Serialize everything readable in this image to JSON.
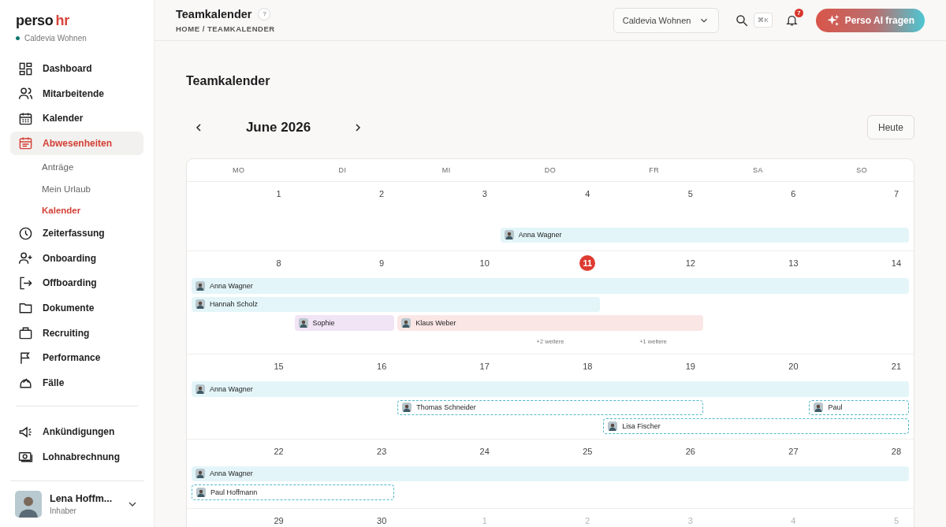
{
  "brand": {
    "name": "perso",
    "accent": "hr",
    "org": "Caldevia Wohnen"
  },
  "nav": [
    {
      "label": "Dashboard",
      "selected": false
    },
    {
      "label": "Mitarbeitende",
      "selected": false
    },
    {
      "label": "Kalender",
      "selected": false
    },
    {
      "label": "Abwesenheiten",
      "selected": true,
      "children": [
        {
          "label": "Anträge",
          "selected": false
        },
        {
          "label": "Mein Urlaub",
          "selected": false
        },
        {
          "label": "Kalender",
          "selected": true
        }
      ]
    },
    {
      "label": "Zeiterfassung",
      "selected": false
    },
    {
      "label": "Onboarding",
      "selected": false
    },
    {
      "label": "Offboarding",
      "selected": false
    },
    {
      "label": "Dokumente",
      "selected": false
    },
    {
      "label": "Recruiting",
      "selected": false
    },
    {
      "label": "Performance",
      "selected": false
    },
    {
      "label": "Fälle",
      "selected": false
    }
  ],
  "nav_bottom": [
    {
      "label": "Ankündigungen",
      "selected": false
    },
    {
      "label": "Lohnabrechnung",
      "selected": false
    }
  ],
  "user": {
    "name": "Lena Hoffm...",
    "role": "Inhaber"
  },
  "header": {
    "title": "Teamkalender",
    "help": "?",
    "breadcrumb": "HOME / TEAMKALENDER",
    "company": "Caldevia Wohnen",
    "shortcut": "⌘K",
    "notifications": "7",
    "ai_button": "Perso AI fragen"
  },
  "page_title": "Teamkalender",
  "month": "June 2026",
  "today_button": "Heute",
  "weekdays": [
    "MO",
    "DI",
    "MI",
    "DO",
    "FR",
    "SA",
    "SO"
  ],
  "weeks": [
    {
      "days": [
        {
          "label": "1",
          "muted": false,
          "today": false
        },
        {
          "label": "2",
          "muted": false,
          "today": false
        },
        {
          "label": "3",
          "muted": false,
          "today": false
        },
        {
          "label": "4",
          "muted": false,
          "today": false
        },
        {
          "label": "5",
          "muted": false,
          "today": false
        },
        {
          "label": "6",
          "muted": false,
          "today": false
        },
        {
          "label": "7",
          "muted": false,
          "today": false
        }
      ],
      "events": [
        {
          "name": "Anna Wagner",
          "kind": "absence",
          "color": "#e3f5f8"
        }
      ]
    },
    {
      "days": [
        {
          "label": "8",
          "muted": false,
          "today": false
        },
        {
          "label": "9",
          "muted": false,
          "today": false
        },
        {
          "label": "10",
          "muted": false,
          "today": false
        },
        {
          "label": "11",
          "muted": false,
          "today": true
        },
        {
          "label": "12",
          "muted": false,
          "today": false
        },
        {
          "label": "13",
          "muted": false,
          "today": false
        },
        {
          "label": "14",
          "muted": false,
          "today": false
        }
      ],
      "events": [
        {
          "name": "Anna Wagner",
          "kind": "absence",
          "color": "#e3f5f8"
        },
        {
          "name": "Hannah Scholz",
          "kind": "absence",
          "color": "#e3f5f8"
        },
        {
          "name": "Sophie",
          "kind": "absence",
          "color": "#f1e4f5"
        },
        {
          "name": "Klaus Weber",
          "kind": "absence",
          "color": "#fbe6e6"
        }
      ],
      "more": [
        "+2 weitere",
        "+1 weitere"
      ]
    },
    {
      "days": [
        {
          "label": "15",
          "muted": false,
          "today": false
        },
        {
          "label": "16",
          "muted": false,
          "today": false
        },
        {
          "label": "17",
          "muted": false,
          "today": false
        },
        {
          "label": "18",
          "muted": false,
          "today": false
        },
        {
          "label": "19",
          "muted": false,
          "today": false
        },
        {
          "label": "20",
          "muted": false,
          "today": false
        },
        {
          "label": "21",
          "muted": false,
          "today": false
        }
      ],
      "events": [
        {
          "name": "Anna Wagner",
          "kind": "absence",
          "color": "#e3f5f8"
        },
        {
          "name": "Thomas Schneider",
          "kind": "pending",
          "color": "#4fb8c9"
        },
        {
          "name": "Paul",
          "kind": "pending",
          "color": "#4fb8c9"
        },
        {
          "name": "Lisa Fischer",
          "kind": "pending",
          "color": "#4fb8c9"
        }
      ]
    },
    {
      "days": [
        {
          "label": "22",
          "muted": false,
          "today": false
        },
        {
          "label": "23",
          "muted": false,
          "today": false
        },
        {
          "label": "24",
          "muted": false,
          "today": false
        },
        {
          "label": "25",
          "muted": false,
          "today": false
        },
        {
          "label": "26",
          "muted": false,
          "today": false
        },
        {
          "label": "27",
          "muted": false,
          "today": false
        },
        {
          "label": "28",
          "muted": false,
          "today": false
        }
      ],
      "events": [
        {
          "name": "Anna Wagner",
          "kind": "absence",
          "color": "#e3f5f8"
        },
        {
          "name": "Paul Hoffmann",
          "kind": "pending",
          "color": "#4fb8c9"
        }
      ]
    },
    {
      "days": [
        {
          "label": "29",
          "muted": false,
          "today": false
        },
        {
          "label": "30",
          "muted": false,
          "today": false
        },
        {
          "label": "1",
          "muted": true,
          "today": false
        },
        {
          "label": "2",
          "muted": true,
          "today": false
        },
        {
          "label": "3",
          "muted": true,
          "today": false
        },
        {
          "label": "4",
          "muted": true,
          "today": false
        },
        {
          "label": "5",
          "muted": true,
          "today": false
        }
      ]
    }
  ]
}
